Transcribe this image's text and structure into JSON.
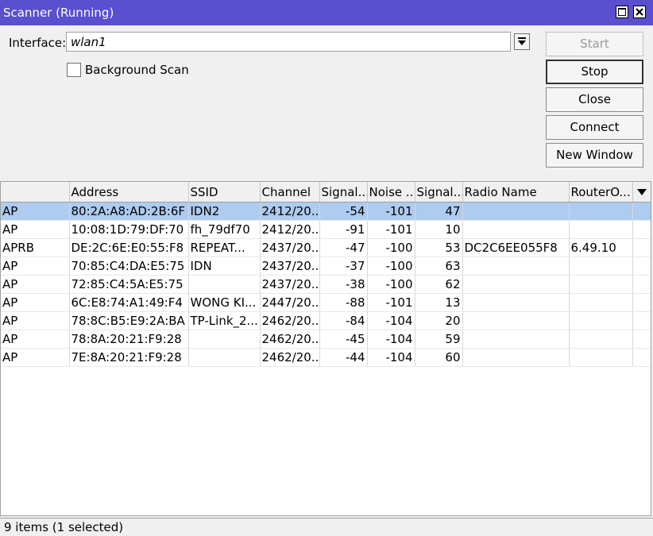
{
  "window": {
    "title": "Scanner (Running)"
  },
  "form": {
    "interface_label": "Interface:",
    "interface_value": "wlan1",
    "background_scan_label": "Background Scan",
    "background_scan_checked": false
  },
  "buttons": {
    "start": "Start",
    "stop": "Stop",
    "close": "Close",
    "connect": "Connect",
    "new_window": "New Window"
  },
  "table": {
    "columns": [
      "",
      "Address",
      "SSID",
      "Channel",
      "Signal...",
      "Noise ...",
      "Signal...",
      "Radio Name",
      "RouterO..."
    ],
    "rows": [
      [
        "AP",
        "80:2A:A8:AD:2B:6F",
        "IDN2",
        "2412/20...",
        "-54",
        "-101",
        "47",
        "",
        ""
      ],
      [
        "AP",
        "10:08:1D:79:DF:70",
        "fh_79df70",
        "2412/20...",
        "-91",
        "-101",
        "10",
        "",
        ""
      ],
      [
        "APRB",
        "DE:2C:6E:E0:55:F8",
        "REPEAT...",
        "2437/20...",
        "-47",
        "-100",
        "53",
        "DC2C6EE055F8",
        "6.49.10"
      ],
      [
        "AP",
        "70:85:C4:DA:E5:75",
        "IDN",
        "2437/20...",
        "-37",
        "-100",
        "63",
        "",
        ""
      ],
      [
        "AP",
        "72:85:C4:5A:E5:75",
        "",
        "2437/20...",
        "-38",
        "-100",
        "62",
        "",
        ""
      ],
      [
        "AP",
        "6C:E8:74:A1:49:F4",
        "WONG KI...",
        "2447/20...",
        "-88",
        "-101",
        "13",
        "",
        ""
      ],
      [
        "AP",
        "78:8C:B5:E9:2A:BA",
        "TP-Link_2...",
        "2462/20...",
        "-84",
        "-104",
        "20",
        "",
        ""
      ],
      [
        "AP",
        "78:8A:20:21:F9:28",
        "",
        "2462/20...",
        "-45",
        "-104",
        "59",
        "",
        ""
      ],
      [
        "AP",
        "7E:8A:20:21:F9:28",
        "",
        "2462/20...",
        "-44",
        "-104",
        "60",
        "",
        ""
      ]
    ],
    "selected_row": 0
  },
  "status": {
    "text": "9 items (1 selected)"
  },
  "colors": {
    "titlebar": "#5a4fcf",
    "selection": "#aecbf0"
  },
  "icons": [
    "maximize-icon",
    "close-icon",
    "dropdown-arrow-icon",
    "column-menu-icon"
  ]
}
